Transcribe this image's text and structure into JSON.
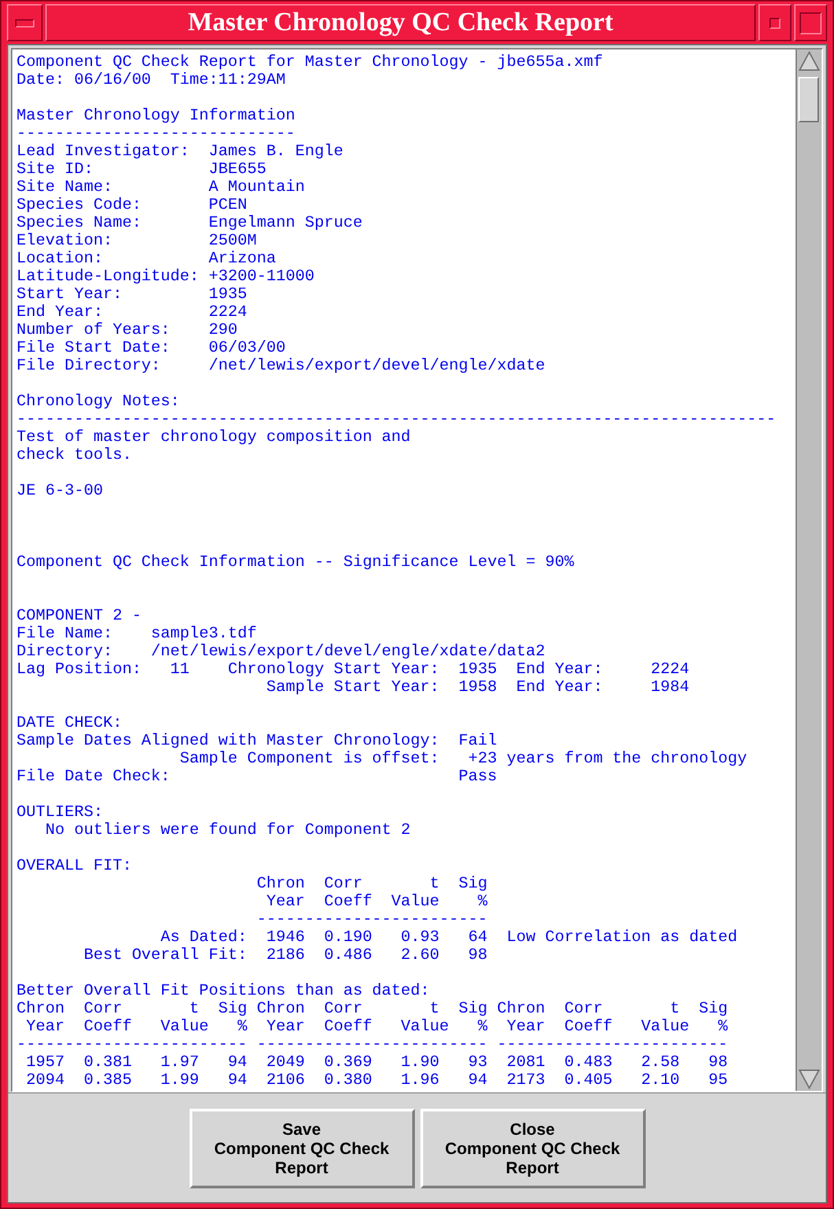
{
  "window": {
    "title": "Master Chronology QC Check Report"
  },
  "report": {
    "items": [
      {
        "kind": "lines",
        "lines": [
          "Component QC Check Report for Master Chronology - jbe655a.xmf",
          "Date: 06/16/00  Time:11:29AM"
        ]
      },
      {
        "kind": "blank"
      },
      {
        "kind": "lines",
        "lines": [
          "Master Chronology Information",
          "-----------------------------",
          "Lead Investigator:  James B. Engle",
          "Site ID:            JBE655",
          "Site Name:          A Mountain",
          "Species Code:       PCEN",
          "Species Name:       Engelmann Spruce",
          "Elevation:          2500M",
          "Location:           Arizona",
          "Latitude-Longitude: +3200-11000",
          "Start Year:         1935",
          "End Year:           2224",
          "Number of Years:    290",
          "File Start Date:    06/03/00",
          "File Directory:     /net/lewis/export/devel/engle/xdate"
        ]
      },
      {
        "kind": "blank"
      },
      {
        "kind": "lines",
        "lines": [
          "Chronology Notes:",
          "-------------------------------------------------------------------------------",
          "Test of master chronology composition and",
          "check tools."
        ]
      },
      {
        "kind": "blank"
      },
      {
        "kind": "lines",
        "lines": [
          "JE 6-3-00"
        ]
      },
      {
        "kind": "blank"
      },
      {
        "kind": "blank"
      },
      {
        "kind": "blank"
      },
      {
        "kind": "lines",
        "lines": [
          "Component QC Check Information -- Significance Level = 90%"
        ]
      },
      {
        "kind": "blank"
      },
      {
        "kind": "blank"
      },
      {
        "kind": "lines",
        "lines": [
          "COMPONENT 2 -",
          "File Name:    sample3.tdf",
          "Directory:    /net/lewis/export/devel/engle/xdate/data2",
          "Lag Position:   11    Chronology Start Year:  1935  End Year:     2224",
          "                          Sample Start Year:  1958  End Year:     1984"
        ]
      },
      {
        "kind": "blank"
      },
      {
        "kind": "lines",
        "lines": [
          "DATE CHECK:",
          "Sample Dates Aligned with Master Chronology:  Fail",
          "                 Sample Component is offset:   +23 years from the chronology",
          "File Date Check:                              Pass"
        ]
      },
      {
        "kind": "blank"
      },
      {
        "kind": "lines",
        "lines": [
          "OUTLIERS:",
          "   No outliers were found for Component 2"
        ]
      },
      {
        "kind": "blank"
      },
      {
        "kind": "lines",
        "lines": [
          "OVERALL FIT:",
          "                         Chron  Corr       t  Sig",
          "                          Year  Coeff  Value    %",
          "                         ------------------------",
          "               As Dated:  1946  0.190   0.93   64  Low Correlation as dated",
          "       Best Overall Fit:  2186  0.486   2.60   98"
        ]
      },
      {
        "kind": "blank"
      },
      {
        "kind": "lines",
        "lines": [
          "Better Overall Fit Positions than as dated:",
          "Chron  Corr       t  Sig Chron  Corr       t  Sig Chron  Corr       t  Sig",
          " Year  Coeff   Value   %  Year  Coeff   Value   %  Year  Coeff   Value   %",
          "------------------------ ------------------------ ------------------------",
          " 1957  0.381   1.97   94  2049  0.369   1.90   93  2081  0.483   2.58   98",
          " 2094  0.385   1.99   94  2106  0.380   1.96   94  2173  0.405   2.10   95"
        ]
      }
    ]
  },
  "buttons": [
    {
      "label": "Save\nComponent QC Check\nReport"
    },
    {
      "label": "Close\nComponent QC Check\nReport"
    }
  ]
}
